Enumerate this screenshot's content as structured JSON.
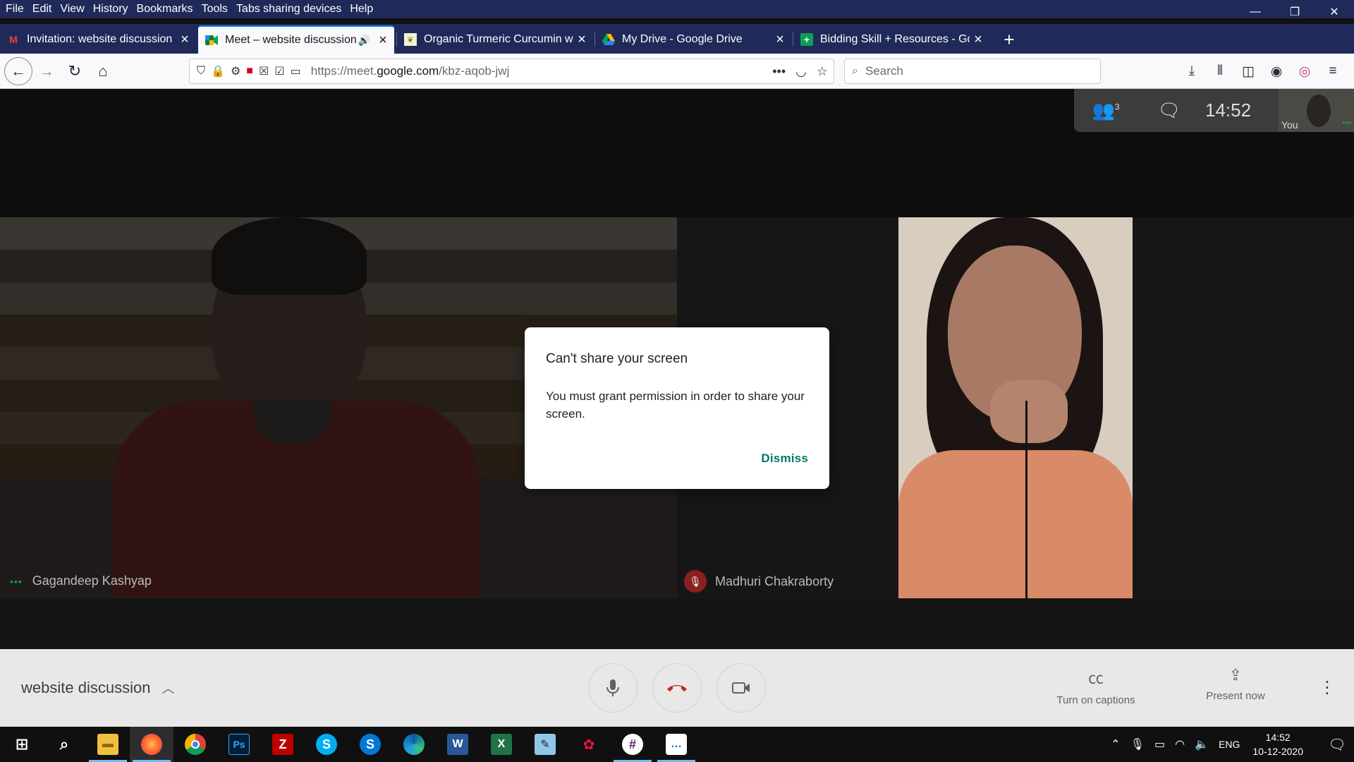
{
  "menu": [
    "File",
    "Edit",
    "View",
    "History",
    "Bookmarks",
    "Tools",
    "Tabs sharing devices",
    "Help"
  ],
  "window_controls": {
    "minimize": "—",
    "restore": "❐",
    "close": "✕"
  },
  "tabs": [
    {
      "title": "Invitation: website discussion @",
      "favicon": "gmail-icon",
      "active": false
    },
    {
      "title": "Meet – website discussion",
      "favicon": "google-meet-icon",
      "active": true,
      "audio": true
    },
    {
      "title": "Organic Turmeric Curcumin wit",
      "favicon": "site-icon",
      "active": false
    },
    {
      "title": "My Drive - Google Drive",
      "favicon": "google-drive-icon",
      "active": false
    },
    {
      "title": "Bidding Skill + Resources - Goo",
      "favicon": "google-sheets-icon",
      "active": false
    }
  ],
  "url": {
    "prefix": "https://meet.",
    "domain": "google.com",
    "path": "/kbz-aqob-jwj"
  },
  "search": {
    "placeholder": "Search"
  },
  "meet": {
    "clock": "14:52",
    "participant_count": "3",
    "self_label": "You",
    "participants": [
      {
        "name": "Gagandeep Kashyap"
      },
      {
        "name": "Madhuri Chakraborty",
        "muted": true
      }
    ],
    "dialog": {
      "title": "Can't share your screen",
      "body": "You must grant permission in order to share your screen.",
      "dismiss": "Dismiss"
    },
    "meeting_title": "website discussion",
    "captions_label": "Turn on captions",
    "present_label": "Present now"
  },
  "taskbar": {
    "apps": [
      "windows-start-icon",
      "search-icon",
      "file-explorer-icon",
      "firefox-icon",
      "chrome-icon",
      "photoshop-icon",
      "filezilla-icon",
      "skype-icon",
      "skype-business-icon",
      "edge-icon",
      "word-icon",
      "excel-icon",
      "notepad-icon",
      "paint-icon",
      "slack-icon",
      "feedback-icon"
    ],
    "language": "ENG",
    "time": "14:52",
    "date": "10-12-2020"
  },
  "colors": {
    "accent_blue": "#0a84ff",
    "meet_teal": "#00796b",
    "chrome_dark": "#1f2a5a",
    "end_call_red": "#c5221f"
  }
}
